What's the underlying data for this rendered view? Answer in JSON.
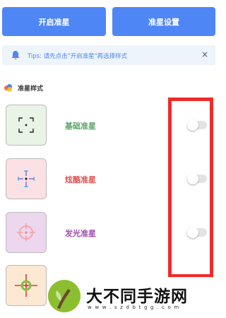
{
  "header": {
    "open_button": "开启准星",
    "settings_button": "准星设置"
  },
  "tips": {
    "text": "Tips: 请先点击\"开启准星\"再选择样式",
    "close": "×"
  },
  "section": {
    "title": "准星样式"
  },
  "styles": [
    {
      "label": "基础准星",
      "color": "#5aa469",
      "thumb_bg": "#e9f3e6",
      "enabled": false
    },
    {
      "label": "炫酷准星",
      "color": "#e0504e",
      "thumb_bg": "#fbe1e4",
      "enabled": false
    },
    {
      "label": "发光准星",
      "color": "#a04db0",
      "thumb_bg": "#ecd7ef",
      "enabled": false
    },
    {
      "label": "",
      "color": "#f08a2a",
      "thumb_bg": "#fde8d3"
    }
  ],
  "colors": {
    "accent": "#4f86f5",
    "highlight": "#f12a2a"
  },
  "watermark": {
    "title": "大不同手游网",
    "url": "w w w . s z d b t g g . c o m"
  }
}
